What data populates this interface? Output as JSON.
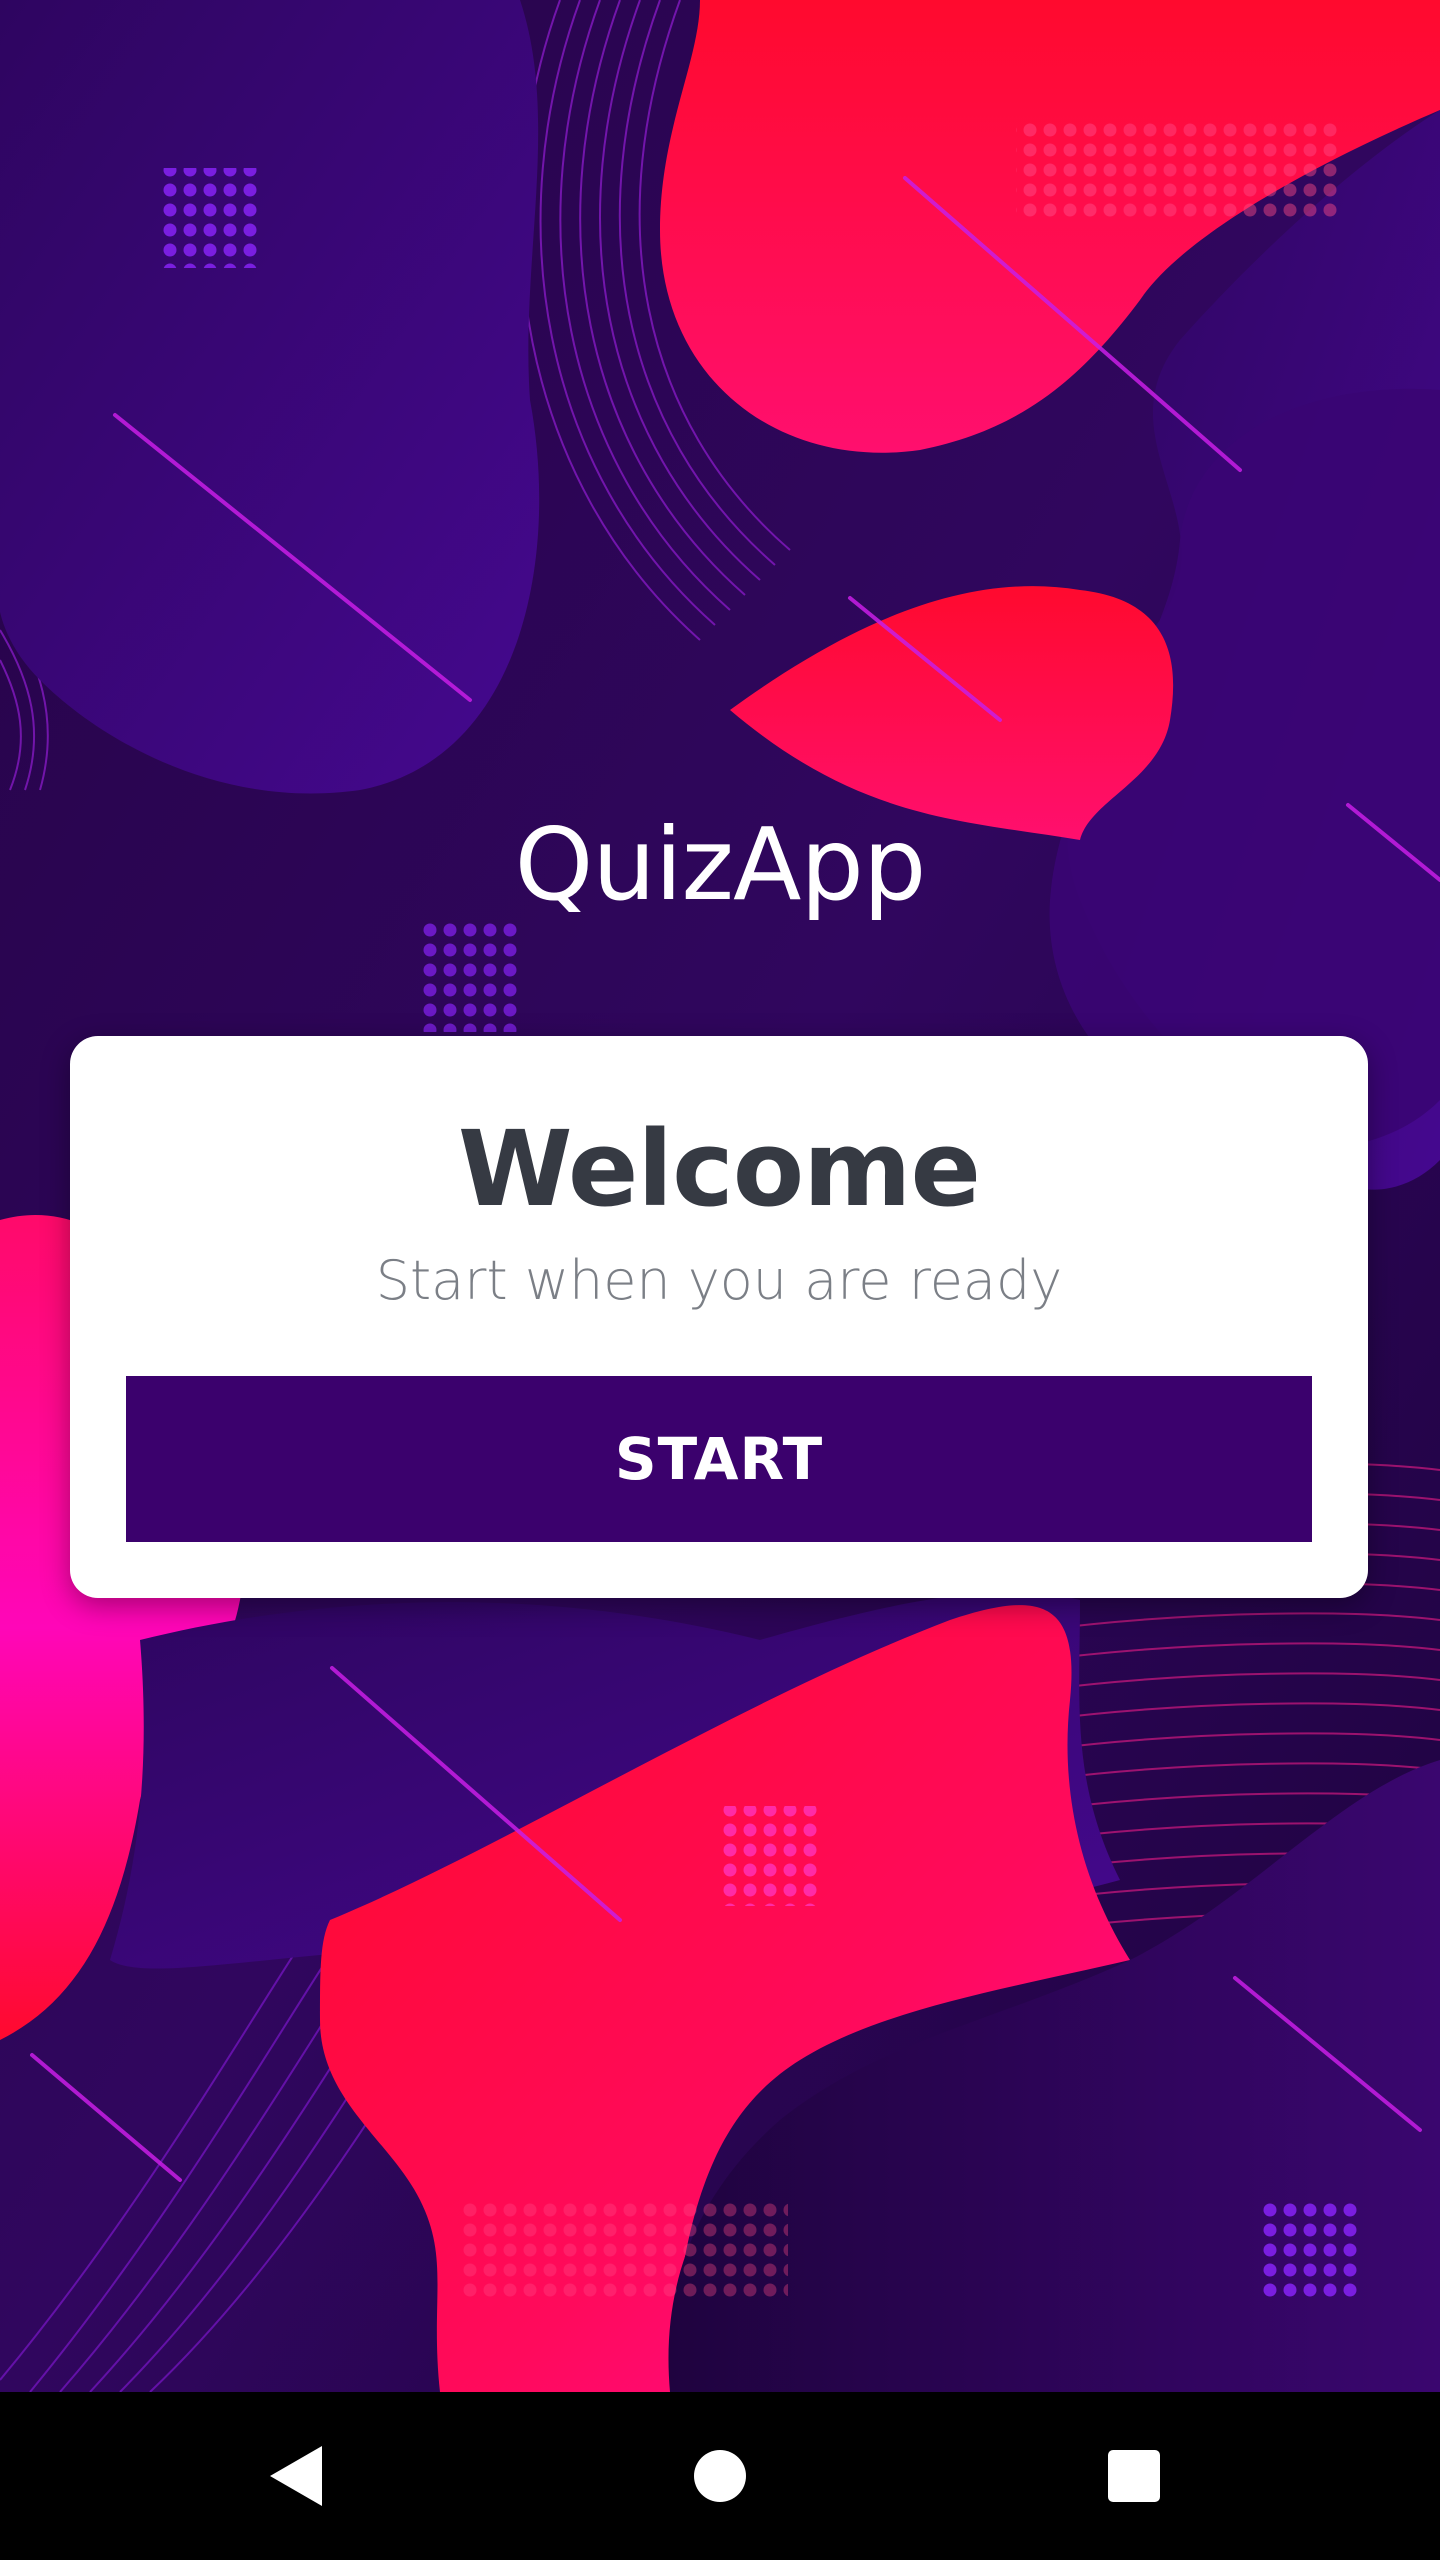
{
  "app": {
    "title": "QuizApp"
  },
  "welcome_card": {
    "title": "Welcome",
    "subtitle": "Start when you are ready",
    "start_button_label": "START"
  },
  "navigation_bar": {
    "back_icon": "triangle-back-icon",
    "home_icon": "circle-home-icon",
    "recents_icon": "square-recents-icon"
  },
  "colors": {
    "background": "#2a0552",
    "blob_purple": "#3c0478",
    "blob_red": "#ff0f3a",
    "blob_pink": "#ff0a8a",
    "button": "#3b016d",
    "card": "#ffffff",
    "title_text": "#363a43",
    "subtitle_text": "#7b7f86"
  }
}
